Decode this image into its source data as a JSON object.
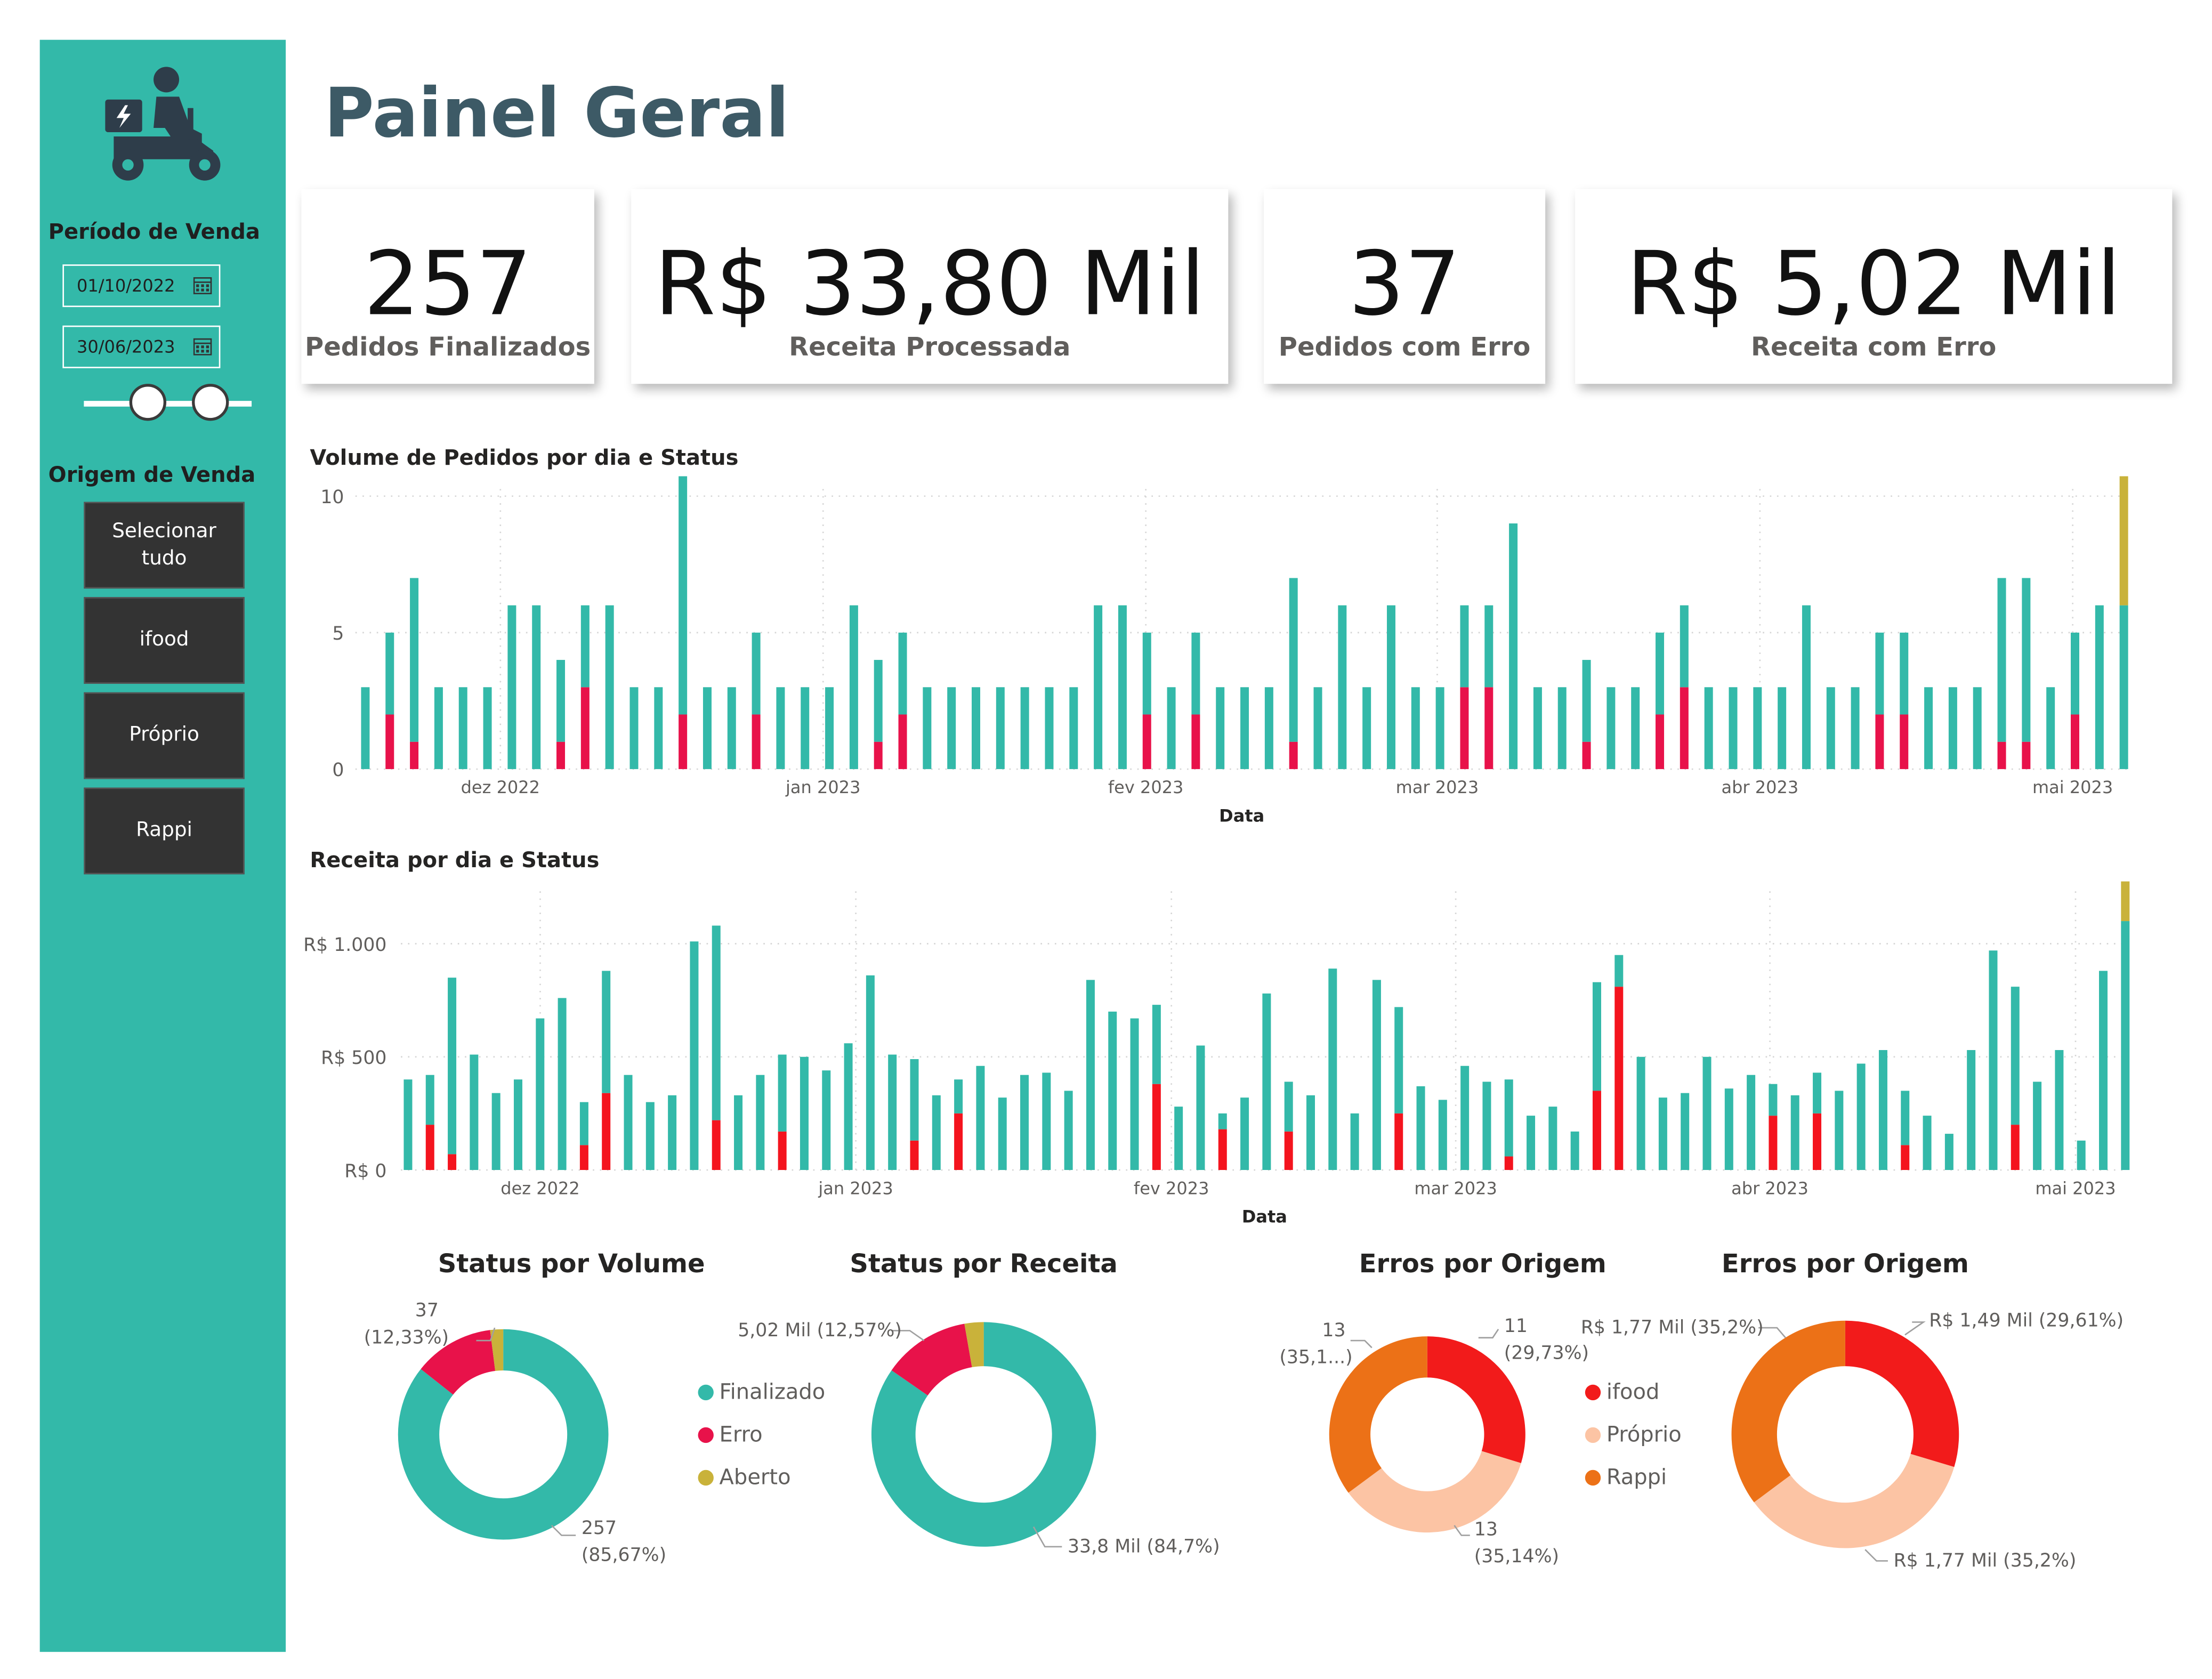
{
  "page": {
    "title": "Painel Geral"
  },
  "sidebar": {
    "periodo_label": "Período de Venda",
    "date_start": "01/10/2022",
    "date_end": "30/06/2023",
    "origem_label": "Origem de Venda",
    "buttons": [
      "Selecionar tudo",
      "ifood",
      "Próprio",
      "Rappi"
    ]
  },
  "kpis": [
    {
      "value": "257",
      "label": "Pedidos Finalizados"
    },
    {
      "value": "R$ 33,80 Mil",
      "label": "Receita Processada"
    },
    {
      "value": "37",
      "label": "Pedidos com Erro"
    },
    {
      "value": "R$ 5,02 Mil",
      "label": "Receita com Erro"
    }
  ],
  "colors": {
    "sidebar": "#33b9a9",
    "finalizado": "#33b9a9",
    "erro": "#e8124a",
    "aberto": "#c9b23a",
    "erro_bar": "#f4141e",
    "ifood": "#f21b1b",
    "proprio": "#fcc4a4",
    "rappi": "#ec7117",
    "title": "#3d5a66"
  },
  "icons": [
    "delivery-scooter-icon",
    "calendar-icon"
  ],
  "chart_data": [
    {
      "type": "bar",
      "title": "Volume de Pedidos por dia e Status",
      "xlabel": "Data",
      "ylabel": "",
      "ylim": [
        0,
        10
      ],
      "yticks": [
        "0",
        "5",
        "10"
      ],
      "xticks": [
        "dez 2022",
        "jan 2023",
        "fev 2023",
        "mar 2023",
        "abr 2023",
        "mai 2023"
      ],
      "stacked": true,
      "series": [
        {
          "name": "Finalizado",
          "values": [
            3,
            3,
            6,
            3,
            3,
            3,
            6,
            6,
            3,
            3,
            6,
            3,
            3,
            9,
            3,
            3,
            3,
            3,
            3,
            3,
            6,
            3,
            3,
            3,
            3,
            3,
            3,
            3,
            3,
            3,
            6,
            6,
            3,
            3,
            3,
            3,
            3,
            3,
            6,
            3,
            6,
            3,
            6,
            3,
            3,
            3,
            3,
            9,
            3,
            3,
            3,
            3,
            3,
            3,
            3,
            3,
            3,
            3,
            3,
            6,
            3,
            3,
            3,
            3,
            3,
            3,
            3,
            6,
            6,
            3,
            3,
            6,
            6
          ]
        },
        {
          "name": "Erro",
          "values": [
            0,
            2,
            1,
            0,
            0,
            0,
            0,
            0,
            1,
            3,
            0,
            0,
            0,
            2,
            0,
            0,
            2,
            0,
            0,
            0,
            0,
            1,
            2,
            0,
            0,
            0,
            0,
            0,
            0,
            0,
            0,
            0,
            2,
            0,
            2,
            0,
            0,
            0,
            1,
            0,
            0,
            0,
            0,
            0,
            0,
            3,
            3,
            0,
            0,
            0,
            1,
            0,
            0,
            2,
            3,
            0,
            0,
            0,
            0,
            0,
            0,
            0,
            2,
            2,
            0,
            0,
            0,
            1,
            1,
            0,
            2,
            0,
            0
          ]
        },
        {
          "name": "Aberto",
          "values": [
            0,
            0,
            0,
            0,
            0,
            0,
            0,
            0,
            0,
            0,
            0,
            0,
            0,
            0,
            0,
            0,
            0,
            0,
            0,
            0,
            0,
            0,
            0,
            0,
            0,
            0,
            0,
            0,
            0,
            0,
            0,
            0,
            0,
            0,
            0,
            0,
            0,
            0,
            0,
            0,
            0,
            0,
            0,
            0,
            0,
            0,
            0,
            0,
            0,
            0,
            0,
            0,
            0,
            0,
            0,
            0,
            0,
            0,
            0,
            0,
            0,
            0,
            0,
            0,
            0,
            0,
            0,
            0,
            0,
            0,
            0,
            0,
            6
          ]
        }
      ]
    },
    {
      "type": "bar",
      "title": "Receita por dia e Status",
      "xlabel": "Data",
      "ylabel": "",
      "ylim": [
        0,
        1200
      ],
      "yticks": [
        "R$ 0",
        "R$ 500",
        "R$ 1.000"
      ],
      "xticks": [
        "dez 2022",
        "jan 2023",
        "fev 2023",
        "mar 2023",
        "abr 2023",
        "mai 2023"
      ],
      "stacked": true,
      "series": [
        {
          "name": "Finalizado",
          "values": [
            400,
            220,
            780,
            510,
            340,
            400,
            670,
            760,
            190,
            540,
            420,
            300,
            330,
            1010,
            860,
            330,
            420,
            340,
            500,
            440,
            560,
            860,
            510,
            360,
            330,
            150,
            460,
            320,
            420,
            430,
            350,
            840,
            700,
            670,
            350,
            280,
            550,
            70,
            320,
            780,
            220,
            330,
            890,
            250,
            840,
            470,
            370,
            310,
            460,
            390,
            340,
            240,
            280,
            170,
            480,
            140,
            500,
            320,
            340,
            500,
            360,
            420,
            140,
            330,
            180,
            350,
            470,
            530,
            240,
            240,
            160,
            530,
            970,
            610,
            390,
            530,
            130,
            880,
            1100
          ]
        },
        {
          "name": "Erro",
          "values": [
            0,
            200,
            70,
            0,
            0,
            0,
            0,
            0,
            110,
            340,
            0,
            0,
            0,
            0,
            220,
            0,
            0,
            170,
            0,
            0,
            0,
            0,
            0,
            130,
            0,
            250,
            0,
            0,
            0,
            0,
            0,
            0,
            0,
            0,
            380,
            0,
            0,
            180,
            0,
            0,
            170,
            0,
            0,
            0,
            0,
            250,
            0,
            0,
            0,
            0,
            60,
            0,
            0,
            0,
            350,
            810,
            0,
            0,
            0,
            0,
            0,
            0,
            240,
            0,
            250,
            0,
            0,
            0,
            110,
            0,
            0,
            0,
            0,
            200,
            0,
            0,
            0,
            0,
            0
          ]
        },
        {
          "name": "Aberto",
          "values": [
            0,
            0,
            0,
            0,
            0,
            0,
            0,
            0,
            0,
            0,
            0,
            0,
            0,
            0,
            0,
            0,
            0,
            0,
            0,
            0,
            0,
            0,
            0,
            0,
            0,
            0,
            0,
            0,
            0,
            0,
            0,
            0,
            0,
            0,
            0,
            0,
            0,
            0,
            0,
            0,
            0,
            0,
            0,
            0,
            0,
            0,
            0,
            0,
            0,
            0,
            0,
            0,
            0,
            0,
            0,
            0,
            0,
            0,
            0,
            0,
            0,
            0,
            0,
            0,
            0,
            0,
            0,
            0,
            0,
            0,
            0,
            0,
            0,
            0,
            0,
            0,
            0,
            0,
            1100
          ]
        }
      ]
    },
    {
      "type": "pie",
      "title": "Status por Volume",
      "categories": [
        "Finalizado",
        "Erro",
        "Aberto"
      ],
      "values": [
        257,
        37,
        6
      ],
      "labels": {
        "main_value": "257",
        "main_pct": "(85,67%)",
        "err_value": "37",
        "err_pct": "(12,33%)"
      }
    },
    {
      "type": "pie",
      "title": "Status por Receita",
      "categories": [
        "Finalizado",
        "Erro",
        "Aberto"
      ],
      "values": [
        33.8,
        5.02,
        1.1
      ],
      "labels": {
        "main": "33,8 Mil (84,7%)",
        "err": "5,02 Mil (12,57%)"
      }
    },
    {
      "type": "pie",
      "title": "Erros por Origem",
      "categories": [
        "ifood",
        "Próprio",
        "Rappi"
      ],
      "values": [
        11,
        13,
        13
      ],
      "labels": {
        "ifood_value": "11",
        "ifood_pct": "(29,73%)",
        "proprio_value": "13",
        "proprio_pct": "(35,14%)",
        "rappi_value": "13",
        "rappi_pct": "(35,1...)"
      }
    },
    {
      "type": "pie",
      "title": "Erros por Origem",
      "categories": [
        "ifood",
        "Próprio",
        "Rappi"
      ],
      "values": [
        1.49,
        1.77,
        1.77
      ],
      "labels": {
        "ifood": "R$ 1,49 Mil (29,61%)",
        "proprio": "R$ 1,77 Mil (35,2%)",
        "rappi": "R$ 1,77 Mil (35,2%)"
      }
    }
  ],
  "legend_status": [
    "Finalizado",
    "Erro",
    "Aberto"
  ],
  "legend_origem": [
    "ifood",
    "Próprio",
    "Rappi"
  ]
}
